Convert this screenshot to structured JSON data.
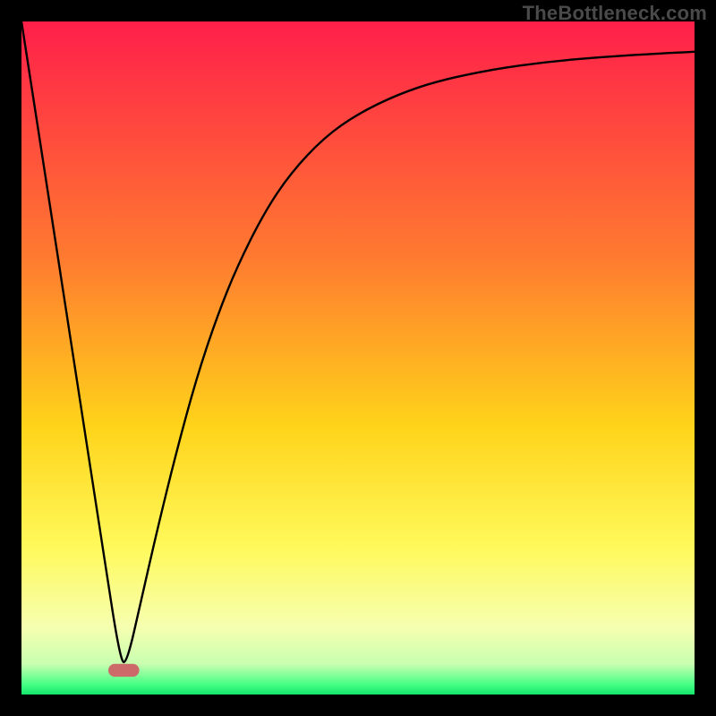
{
  "watermark": "TheBottleneck.com",
  "chart_data": {
    "type": "line",
    "title": "",
    "xlabel": "",
    "ylabel": "",
    "xlim": [
      0,
      100
    ],
    "ylim": [
      0,
      100
    ],
    "grid": false,
    "gradient_stops": [
      {
        "offset": 0.0,
        "color": "#ff1f4a"
      },
      {
        "offset": 0.35,
        "color": "#ff7a30"
      },
      {
        "offset": 0.6,
        "color": "#ffd31a"
      },
      {
        "offset": 0.78,
        "color": "#fff95a"
      },
      {
        "offset": 0.9,
        "color": "#f6ffb0"
      },
      {
        "offset": 0.955,
        "color": "#c8ffb0"
      },
      {
        "offset": 0.985,
        "color": "#47ff85"
      },
      {
        "offset": 1.0,
        "color": "#14e56b"
      }
    ],
    "series": [
      {
        "name": "bottleneck-curve",
        "x": [
          0.0,
          3.0,
          6.0,
          9.0,
          12.0,
          14.7,
          15.7,
          18.0,
          20.3,
          23.0,
          26.0,
          29.0,
          32.0,
          36.0,
          40.0,
          45.0,
          50.0,
          56.0,
          62.0,
          70.0,
          78.0,
          86.0,
          94.0,
          100.0
        ],
        "values": [
          100.0,
          80.6,
          61.2,
          41.7,
          22.3,
          4.8,
          4.8,
          15.0,
          25.0,
          36.0,
          47.0,
          56.0,
          63.5,
          71.5,
          77.5,
          82.8,
          86.3,
          89.2,
          91.2,
          92.9,
          94.0,
          94.7,
          95.2,
          95.5
        ]
      }
    ],
    "marker": {
      "name": "minimum-region",
      "shape": "pill",
      "color": "#cc6a6a",
      "x_center": 15.2,
      "width": 4.6,
      "y": 3.6,
      "height": 1.9
    }
  }
}
